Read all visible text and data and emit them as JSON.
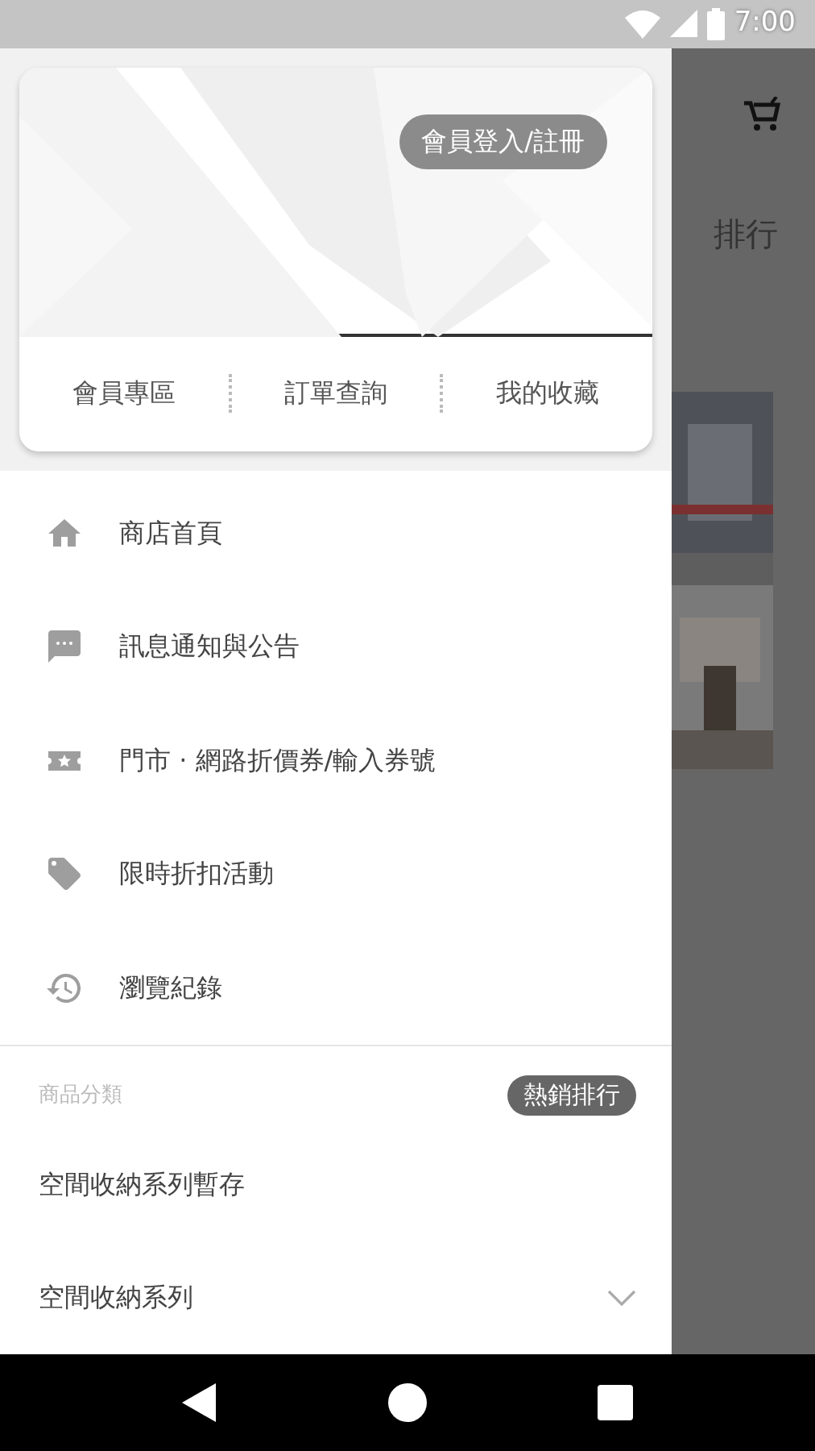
{
  "status_bar": {
    "time": "7:00"
  },
  "background": {
    "section_title": "排行"
  },
  "drawer": {
    "login_button": "會員登入/註冊",
    "quick_links": [
      "會員專區",
      "訂單查詢",
      "我的收藏"
    ],
    "menu": [
      {
        "kind": "home",
        "label": "商店首頁"
      },
      {
        "kind": "message",
        "label": "訊息通知與公告"
      },
      {
        "kind": "coupon",
        "label": "門市 · 網路折價券/輸入券號"
      },
      {
        "kind": "tag",
        "label": "限時折扣活動"
      },
      {
        "kind": "history",
        "label": "瀏覽紀錄"
      }
    ],
    "category_header": "商品分類",
    "hot_button": "熱銷排行",
    "categories": [
      {
        "kind": "plain",
        "label": "空間收納系列暫存"
      },
      {
        "kind": "expandable",
        "label": "空間收納系列",
        "expanded": false
      }
    ]
  }
}
